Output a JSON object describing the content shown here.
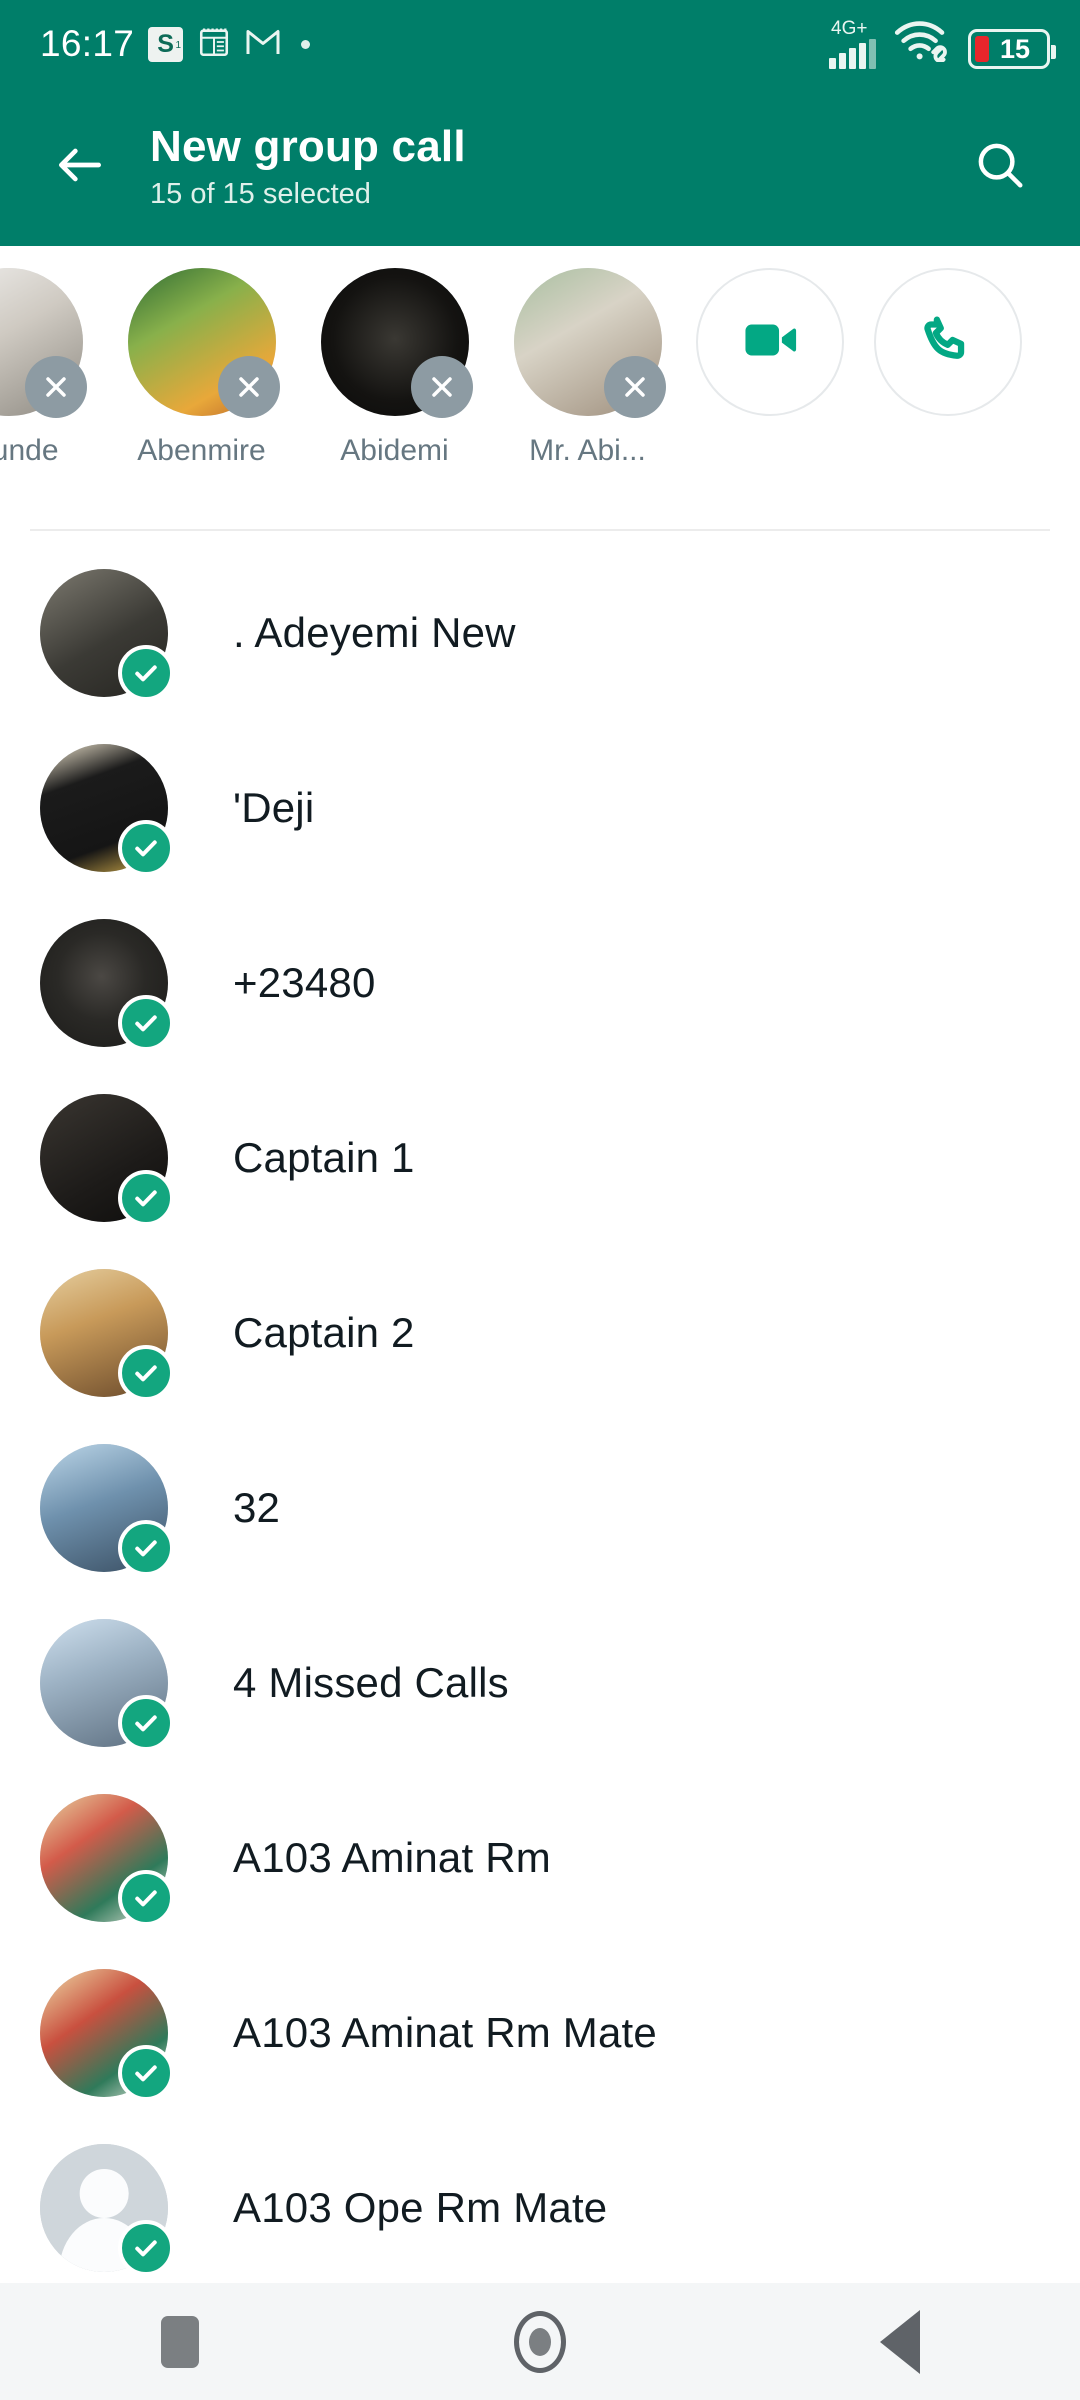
{
  "status_bar": {
    "time": "16:17",
    "scrabble_badge": "S",
    "network_label": "4G+",
    "battery_level": "15",
    "icons": [
      "scrabble-icon",
      "calendar-icon",
      "gmail-icon",
      "dot-icon",
      "signal-icon",
      "wifi-icon",
      "battery-icon"
    ]
  },
  "app_bar": {
    "back_icon": "back-arrow-icon",
    "title": "New group call",
    "subtitle": "15 of 15 selected",
    "search_icon": "search-icon"
  },
  "selected_chips": {
    "items": [
      {
        "name": "egunde",
        "remove_icon": "remove-x-icon"
      },
      {
        "name": "Abenmire",
        "remove_icon": "remove-x-icon"
      },
      {
        "name": "Abidemi",
        "remove_icon": "remove-x-icon"
      },
      {
        "name": "Mr. Abi...",
        "remove_icon": "remove-x-icon"
      }
    ],
    "video_call_icon": "video-camera-icon",
    "voice_call_icon": "phone-icon"
  },
  "contacts": {
    "rows": [
      {
        "name": ". Adeyemi New",
        "selected": true
      },
      {
        "name": "'Deji",
        "selected": true
      },
      {
        "name": "+23480",
        "selected": true
      },
      {
        "name": "Captain 1",
        "selected": true
      },
      {
        "name": "Captain 2",
        "selected": true
      },
      {
        "name": "32",
        "selected": true
      },
      {
        "name": "4 Missed Calls",
        "selected": true
      },
      {
        "name": "A103 Aminat Rm",
        "selected": true
      },
      {
        "name": "A103 Aminat Rm Mate",
        "selected": true
      },
      {
        "name": "A103 Ope Rm Mate",
        "selected": true
      }
    ]
  },
  "nav_bar": {
    "recents_label": "recents",
    "home_label": "home",
    "back_label": "back"
  },
  "colors": {
    "header_green": "#007E69",
    "check_green": "#13a67f",
    "chip_x_gray": "#8d9ba3",
    "text_primary": "#111b21",
    "text_secondary": "#667781",
    "nav_bg": "#f4f6f7"
  }
}
